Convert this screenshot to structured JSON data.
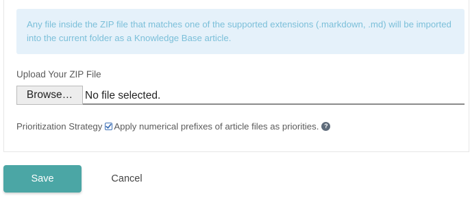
{
  "info": {
    "text": "Any file inside the ZIP file that matches one of the supported extensions (.markdown, .md) will be imported into the current folder as a Knowledge Base article."
  },
  "upload": {
    "label": "Upload Your ZIP File",
    "browse_label": "Browse…",
    "file_status": "No file selected."
  },
  "prioritization": {
    "label": "Prioritization Strategy",
    "checkbox_label": "Apply numerical prefixes of article files as priorities.",
    "checked": true,
    "help_icon": "question-circle-icon"
  },
  "actions": {
    "save_label": "Save",
    "cancel_label": "Cancel"
  },
  "colors": {
    "info_bg": "#e5f1fa",
    "info_text": "#7bbfd9",
    "save_bg": "#4ba6a5"
  }
}
